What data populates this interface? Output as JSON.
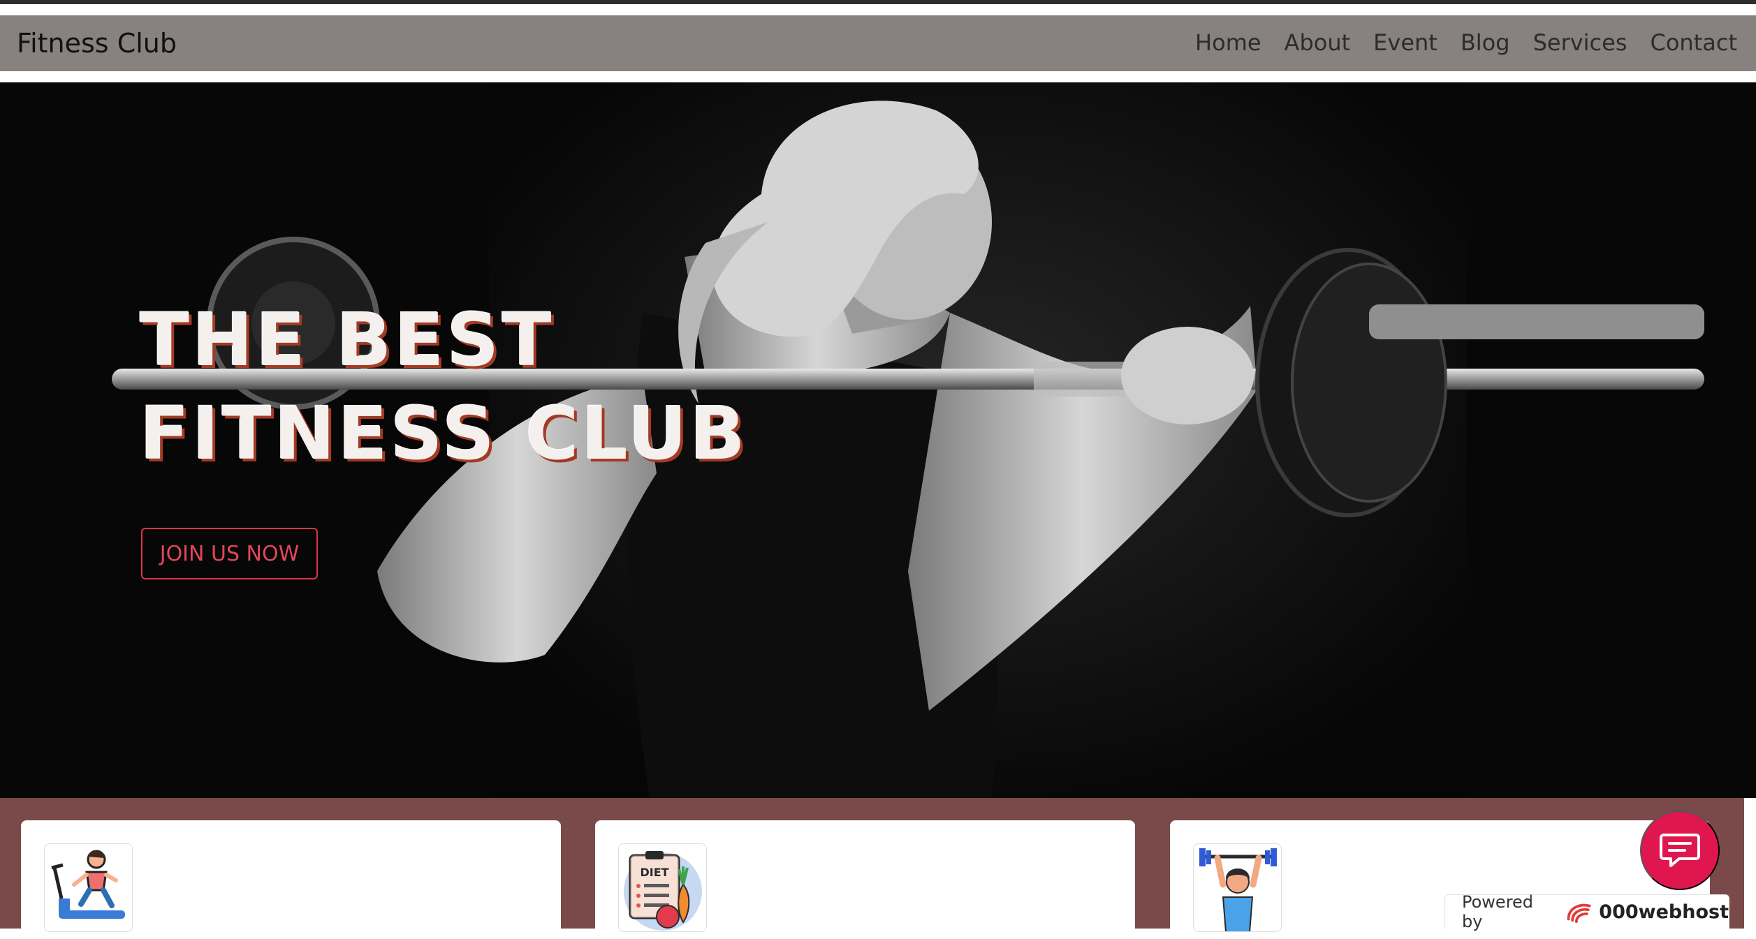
{
  "navbar": {
    "brand": "Fitness Club",
    "links": [
      "Home",
      "About",
      "Event",
      "Blog",
      "Services",
      "Contact"
    ]
  },
  "hero": {
    "title_line1": "THE BEST",
    "title_line2": "FITNESS CLUB",
    "cta_label": "JOIN US NOW",
    "image_icon": "woman-barbell-photo"
  },
  "services": {
    "cards": [
      {
        "icon": "treadmill-runner-icon"
      },
      {
        "icon": "diet-plan-icon"
      },
      {
        "icon": "weightlifter-icon"
      }
    ]
  },
  "chat": {
    "icon": "chat-bubble-icon"
  },
  "badge": {
    "label": "Powered by",
    "brand": "000webhost"
  },
  "colors": {
    "navbar_bg": "#878180",
    "accent": "#dc3545",
    "services_bg": "#7a4a4a",
    "chat_fab": "#e0174f"
  }
}
